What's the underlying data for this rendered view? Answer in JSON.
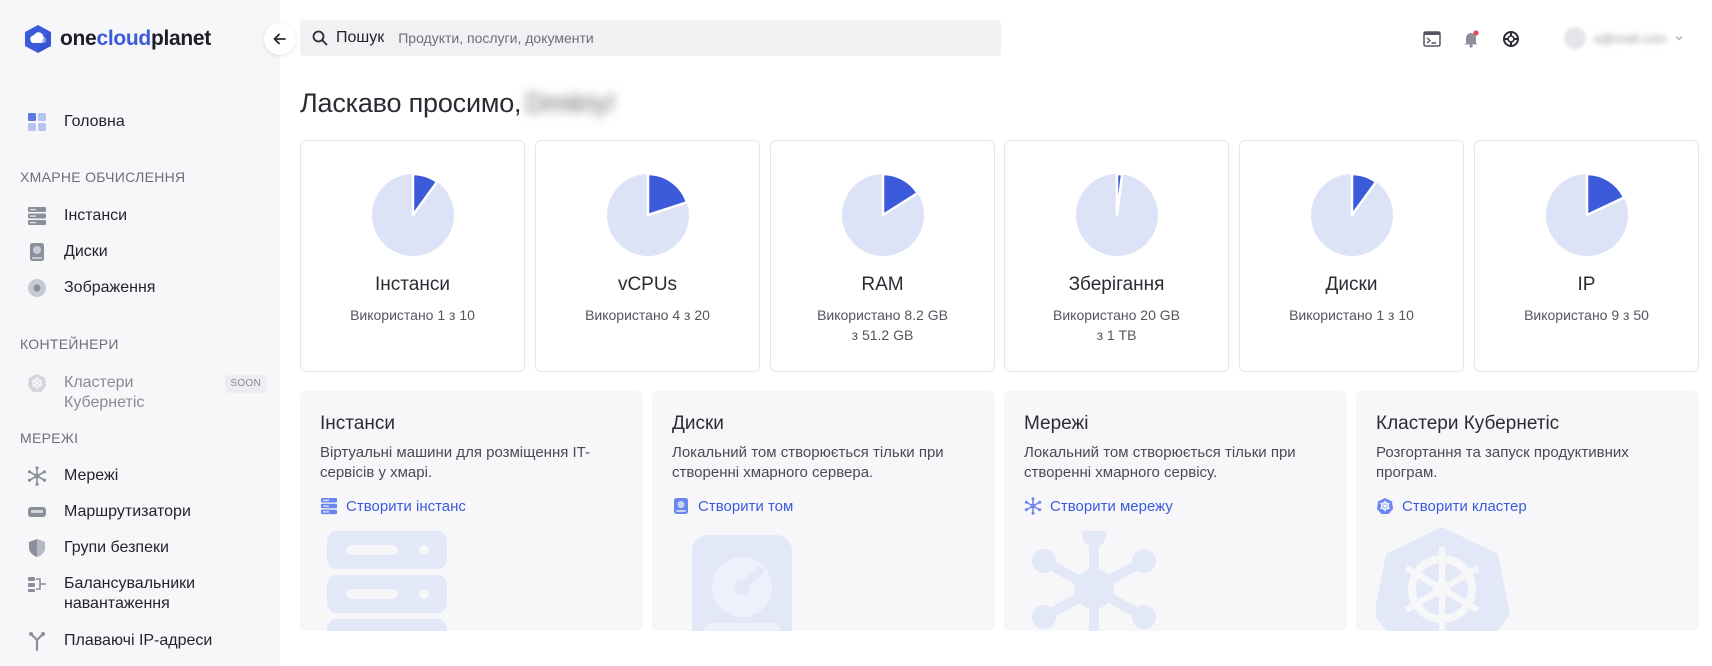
{
  "brand": {
    "part1": "one",
    "part2": "cloud",
    "part3": "planet"
  },
  "sidebar": {
    "home": "Головна",
    "sections": {
      "compute": "ХМАРНЕ ОБЧИСЛЕННЯ",
      "containers": "КОНТЕЙНЕРИ",
      "networks": "МЕРЕЖІ"
    },
    "items": {
      "instances": "Інстанси",
      "disks": "Диски",
      "images": "Зображення",
      "kubernetes": "Кластери Кубернетіс",
      "kubernetes_badge": "SOON",
      "networks": "Мережі",
      "routers": "Маршрутизатори",
      "security_groups": "Групи безпеки",
      "load_balancers": "Балансувальники навантаження",
      "floating_ips": "Плаваючі IP-адреси"
    }
  },
  "search": {
    "label": "Пошук",
    "placeholder": "Продукти, послуги, документи"
  },
  "user": {
    "email": "a@mail.com"
  },
  "welcome": {
    "text": "Ласкаво просимо,",
    "name": "Dmitriy!"
  },
  "stats": [
    {
      "title": "Інстанси",
      "used": "Використано 1 з 10",
      "fraction": 0.1
    },
    {
      "title": "vCPUs",
      "used": "Використано 4 з 20",
      "fraction": 0.2
    },
    {
      "title": "RAM",
      "used": "Використано 8.2 GB з 51.2 GB",
      "fraction": 0.16
    },
    {
      "title": "Зберігання",
      "used": "Використано 20 GB з 1 TB",
      "fraction": 0.02
    },
    {
      "title": "Диски",
      "used": "Використано 1 з 10",
      "fraction": 0.1
    },
    {
      "title": "IP",
      "used": "Використано 9 з 50",
      "fraction": 0.18
    }
  ],
  "cards": [
    {
      "title": "Інстанси",
      "desc": "Віртуальні машини для розміщення IT-сервісів у хмарі.",
      "link": "Створити інстанс"
    },
    {
      "title": "Диски",
      "desc": "Локальний том створюється тільки при створенні хмарного сервера.",
      "link": "Створити том"
    },
    {
      "title": "Мережі",
      "desc": "Локальний том створюється тільки при створенні хмарного сервісу.",
      "link": "Створити мережу"
    },
    {
      "title": "Кластери Кубернетіс",
      "desc": "Розгортання та запуск продуктивних програм.",
      "link": "Створити кластер"
    }
  ],
  "colors": {
    "accent": "#3b5bdb",
    "pie_bg": "#dde3f7"
  }
}
